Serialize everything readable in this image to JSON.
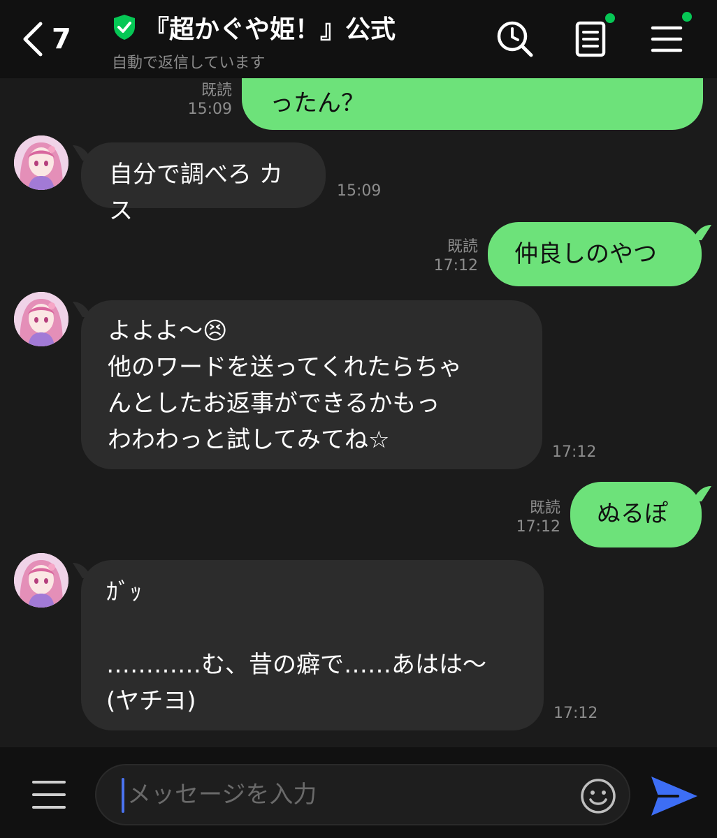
{
  "header": {
    "back_count": "7",
    "title": "『超かぐや姫！』公式",
    "subtitle": "自動で返信しています",
    "icons": [
      "chevron-left-icon",
      "verified-shield-icon",
      "search-clock-icon",
      "notes-icon",
      "menu-icon"
    ]
  },
  "messages": [
    {
      "dir": "out",
      "text": "ったん？",
      "read_label": "既読",
      "time": "15:09"
    },
    {
      "dir": "in",
      "text": "自分で調べろ カス",
      "time": "15:09"
    },
    {
      "dir": "out",
      "text": "仲良しのやつ",
      "read_label": "既読",
      "time": "17:12"
    },
    {
      "dir": "in",
      "text": "よよよ〜😣\n他のワードを送ってくれたらちゃ\nんとしたお返事ができるかもっ\nわわわっと試してみてね☆",
      "time": "17:12"
    },
    {
      "dir": "out",
      "text": "ぬるぽ",
      "read_label": "既読",
      "time": "17:12"
    },
    {
      "dir": "in",
      "text": "ｶﾞｯ\n\n…………む、昔の癖で……あはは〜\n(ヤチヨ)",
      "time": "17:12"
    }
  ],
  "input": {
    "placeholder": "メッセージを入力"
  },
  "colors": {
    "background": "#1b1b1b",
    "header_bg": "#111111",
    "incoming_bubble": "#2c2c2c",
    "outgoing_bubble": "#6de27a",
    "notification_dot": "#06c755",
    "send_accent": "#3d6ef5",
    "caret": "#4a73f0"
  }
}
